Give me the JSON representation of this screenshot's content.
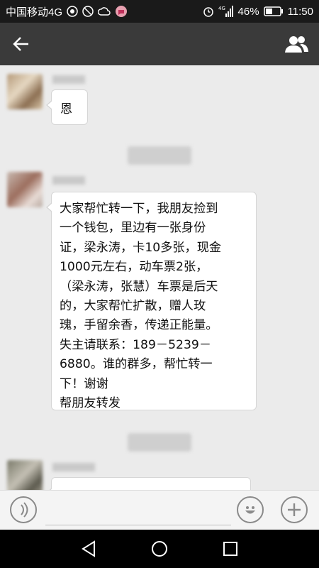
{
  "status_bar": {
    "carrier": "中国移动4G",
    "battery": "46%",
    "time": "11:50",
    "network_label": "4G"
  },
  "title_bar": {
    "back_icon": "arrow-left-icon",
    "title": "",
    "contacts_icon": "group-icon"
  },
  "messages": [
    {
      "type": "text",
      "text": "恩"
    },
    {
      "type": "text",
      "text": "大家帮忙转一下，我朋友捡到\n一个钱包，里边有一张身份\n证，梁永涛，卡10多张，现金\n1000元左右，动车票2张，\n（梁永涛，张慧）车票是后天\n的，大家帮忙扩散，赠人玫\n瑰，手留余香，传递正能量。\n失主请联系：189－5239－\n6880。谁的群多，帮忙转一\n下！谢谢\n帮朋友转发"
    }
  ],
  "input_bar": {
    "voice_icon": "voice-icon",
    "emoji_icon": "emoji-icon",
    "plus_icon": "plus-icon"
  },
  "nav_bar": {
    "back_icon": "triangle-back-icon",
    "home_icon": "circle-home-icon",
    "recents_icon": "square-recents-icon"
  },
  "colors": {
    "title_bar_bg": "#3a3a3a",
    "status_bar_bg": "#1a1a1a",
    "chat_bg": "#ebebeb",
    "bubble_bg": "#ffffff"
  }
}
